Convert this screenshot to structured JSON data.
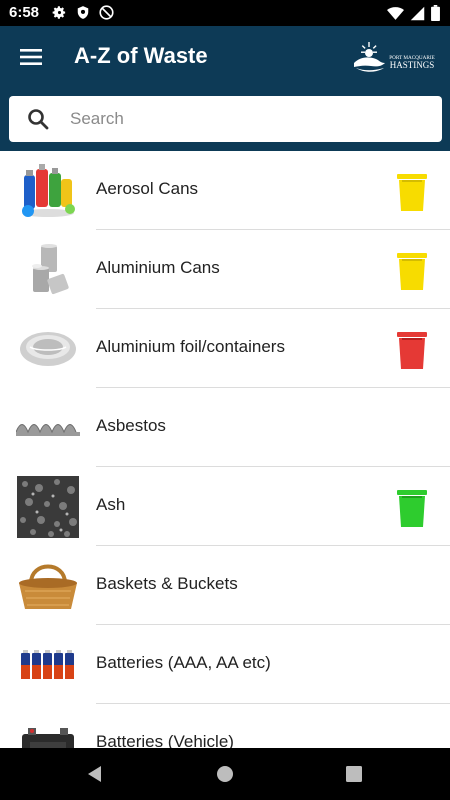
{
  "status_bar": {
    "time": "6:58"
  },
  "app_bar": {
    "title": "A-Z of Waste",
    "logo_line1": "PORT MACQUARIE",
    "logo_line2": "HASTINGS"
  },
  "search": {
    "placeholder": "Search",
    "value": ""
  },
  "colors": {
    "header": "#0d3a56",
    "bin_yellow": "#f7dc00",
    "bin_red": "#e53935",
    "bin_green": "#2ecc2e"
  },
  "items": [
    {
      "label": "Aerosol Cans",
      "icon": "aerosol-cans-image",
      "bin": "yellow"
    },
    {
      "label": "Aluminium Cans",
      "icon": "aluminium-cans-image",
      "bin": "yellow"
    },
    {
      "label": "Aluminium foil/containers",
      "icon": "aluminium-foil-image",
      "bin": "red"
    },
    {
      "label": "Asbestos",
      "icon": "asbestos-image",
      "bin": "none"
    },
    {
      "label": "Ash",
      "icon": "ash-image",
      "bin": "green"
    },
    {
      "label": "Baskets & Buckets",
      "icon": "basket-image",
      "bin": "none"
    },
    {
      "label": "Batteries (AAA, AA etc)",
      "icon": "batteries-image",
      "bin": "none"
    },
    {
      "label": "Batteries (Vehicle)",
      "icon": "vehicle-battery-image",
      "bin": "none"
    }
  ]
}
